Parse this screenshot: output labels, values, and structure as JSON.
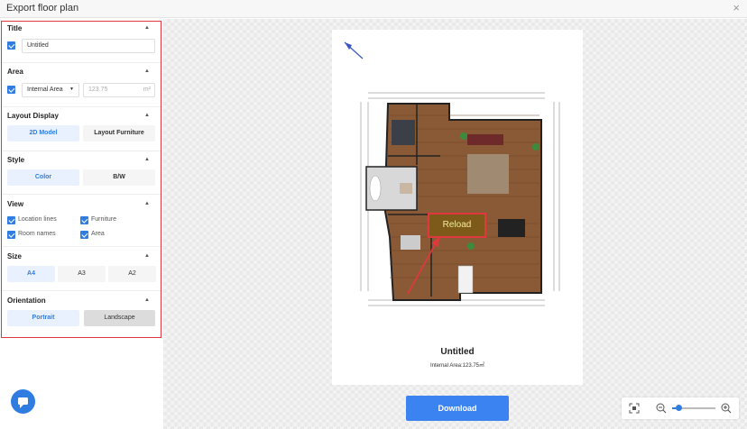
{
  "header": {
    "title": "Export floor plan",
    "close_icon": "×"
  },
  "sections": {
    "title": {
      "label": "Title",
      "checked": true,
      "value": "Untitled"
    },
    "area": {
      "label": "Area",
      "checked": true,
      "select_value": "Internal Area",
      "value": "123.75",
      "unit": "m²"
    },
    "layout_display": {
      "label": "Layout Display",
      "options": [
        "2D Model",
        "Layout Furniture"
      ],
      "selected": "2D Model"
    },
    "style": {
      "label": "Style",
      "options": [
        "Color",
        "B/W"
      ],
      "selected": "Color"
    },
    "view": {
      "label": "View",
      "items": [
        {
          "label": "Location lines",
          "checked": true
        },
        {
          "label": "Furniture",
          "checked": true
        },
        {
          "label": "Room names",
          "checked": true
        },
        {
          "label": "Area",
          "checked": true
        }
      ]
    },
    "size": {
      "label": "Size",
      "options": [
        "A4",
        "A3",
        "A2"
      ],
      "selected": "A4"
    },
    "orientation": {
      "label": "Orientation",
      "options": [
        "Portrait",
        "Landscape"
      ],
      "selected": "Portrait"
    }
  },
  "preview": {
    "plan_title": "Untitled",
    "area_text": "Internal Area:123.75㎡",
    "reload_label": "Reload"
  },
  "actions": {
    "download_label": "Download"
  },
  "zoom": {
    "level": 0.15
  },
  "icons": {
    "chat": "chat-icon",
    "fit": "fit-screen-icon",
    "zoom_out": "zoom-out-icon",
    "zoom_in": "zoom-in-icon",
    "compass": "compass-icon"
  },
  "colors": {
    "accent": "#2f7de1",
    "highlight": "#e0383e",
    "download": "#3b83f0"
  }
}
